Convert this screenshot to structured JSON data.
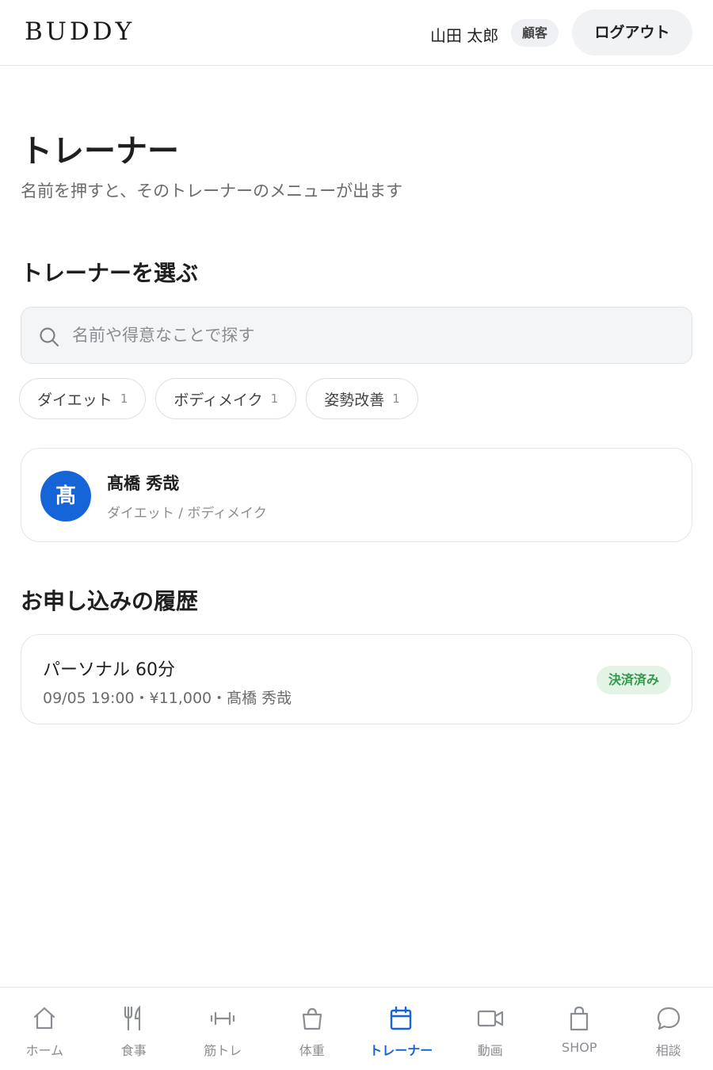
{
  "header": {
    "logo": "BUDDY",
    "user_name": "山田 太郎",
    "role": "顧客",
    "logout_label": "ログアウト"
  },
  "page": {
    "title": "トレーナー",
    "subtitle": "名前を押すと、そのトレーナーのメニューが出ます"
  },
  "select_section": {
    "heading": "トレーナーを選ぶ",
    "search_placeholder": "名前や得意なことで探す",
    "search_value": "",
    "chips": [
      {
        "label": "ダイエット",
        "count": "1"
      },
      {
        "label": "ボディメイク",
        "count": "1"
      },
      {
        "label": "姿勢改善",
        "count": "1"
      }
    ]
  },
  "trainers": [
    {
      "initial": "髙",
      "name": "髙橋 秀哉",
      "tags": "ダイエット / ボディメイク",
      "avatar_color": "#1565d8"
    }
  ],
  "history_section": {
    "heading": "お申し込みの履歴",
    "items": [
      {
        "title": "パーソナル 60分",
        "meta": "09/05 19:00・¥11,000・髙橋 秀哉",
        "status": "決済済み"
      }
    ]
  },
  "bottom_nav": {
    "active_color": "#1565d8",
    "items": [
      {
        "label": "ホーム",
        "icon": "home-icon"
      },
      {
        "label": "食事",
        "icon": "fork-knife-icon"
      },
      {
        "label": "筋トレ",
        "icon": "dumbbell-icon"
      },
      {
        "label": "体重",
        "icon": "scale-icon"
      },
      {
        "label": "トレーナー",
        "icon": "calendar-icon",
        "active": true
      },
      {
        "label": "動画",
        "icon": "video-icon"
      },
      {
        "label": "SHOP",
        "icon": "shopping-bag-icon"
      },
      {
        "label": "相談",
        "icon": "chat-bubble-icon"
      }
    ]
  }
}
